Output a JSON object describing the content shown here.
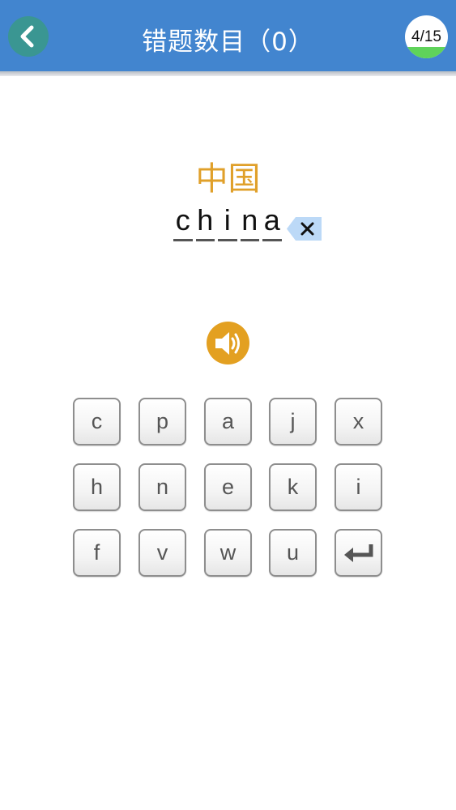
{
  "header": {
    "title": "错题数目（0）",
    "progress_text": "4/15",
    "progress_fraction": 0.267
  },
  "word": {
    "chinese": "中国",
    "letters": [
      "c",
      "h",
      "i",
      "n",
      "a"
    ]
  },
  "keyboard": {
    "keys": [
      "c",
      "p",
      "a",
      "j",
      "x",
      "h",
      "n",
      "e",
      "k",
      "i",
      "f",
      "v",
      "w",
      "u"
    ],
    "enter_icon": "enter-icon"
  },
  "icons": {
    "back": "chevron-left-icon",
    "delete": "backspace-icon",
    "speaker": "speaker-icon"
  },
  "colors": {
    "header_bg": "#4285cf",
    "back_bg": "#3a9692",
    "accent_orange": "#e3a021",
    "word_color": "#e0a02a",
    "progress_fill": "#5fd35a",
    "delete_bg": "#bcd9f7"
  }
}
